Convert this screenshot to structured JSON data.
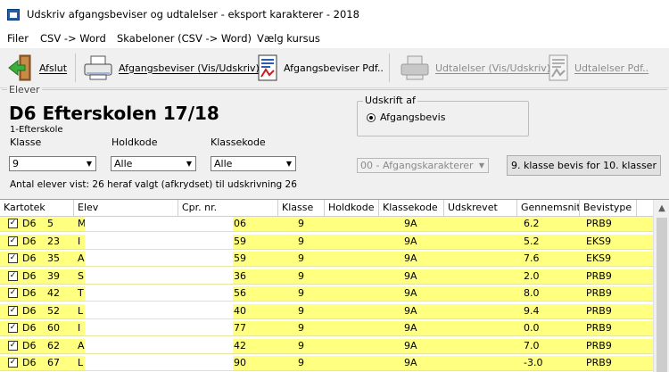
{
  "window": {
    "title": "Udskriv afgangsbeviser og udtalelser - eksport karakterer - 2018"
  },
  "menu": [
    "Filer",
    "CSV -> Word",
    "Skabeloner (CSV -> Word)",
    "Vælg kursus"
  ],
  "toolbar": {
    "exit": "Afslut",
    "certificates": "Afgangsbeviser (Vis/Udskriv)",
    "certificates_pdf": "Afgangsbeviser Pdf..",
    "statements": "Udtalelser (Vis/Udskriv)",
    "statements_pdf": "Udtalelser Pdf..",
    "icons": [
      "exit-door-icon",
      "printer-icon",
      "pdf-document-icon",
      "printer-icon",
      "document-icon"
    ]
  },
  "panel": {
    "legend": "Elever",
    "school_title": "D6 Efterskolen 17/18",
    "school_subtitle": "1-Efterskole",
    "klasse_label": "Klasse",
    "klasse_value": "9",
    "holdkode_label": "Holdkode",
    "holdkode_value": "Alle",
    "klassekode_label": "Klassekode",
    "klassekode_value": "Alle",
    "print_group_title": "Udskrift af",
    "print_radio_label": "Afgangsbevis",
    "grades_combo": "00 - Afgangskarakterer",
    "bevis_button": "9. klasse bevis for 10. klasser",
    "count_text": "Antal elever vist: 26 heraf valgt (afkrydset) til udskrivning 26"
  },
  "grid": {
    "columns": [
      "Kartotek",
      "Elev",
      "Cpr. nr.",
      "Klasse",
      "Holdkode",
      "Klassekode",
      "Udskrevet",
      "Gennemsnit",
      "Bevistype"
    ],
    "rows": [
      {
        "check": "✓",
        "kartotek": "D6",
        "nr": "5",
        "elev": "M",
        "cpr": "06",
        "klasse": "9",
        "klassekode": "9A",
        "gennemsnit": "6.2",
        "bevistype": "PRB9"
      },
      {
        "check": "✓",
        "kartotek": "D6",
        "nr": "23",
        "elev": "I",
        "cpr": "59",
        "klasse": "9",
        "klassekode": "9A",
        "gennemsnit": "5.2",
        "bevistype": "EKS9"
      },
      {
        "check": "✓",
        "kartotek": "D6",
        "nr": "35",
        "elev": "A",
        "cpr": "59",
        "klasse": "9",
        "klassekode": "9A",
        "gennemsnit": "7.6",
        "bevistype": "EKS9"
      },
      {
        "check": "✓",
        "kartotek": "D6",
        "nr": "39",
        "elev": "S",
        "cpr": "36",
        "klasse": "9",
        "klassekode": "9A",
        "gennemsnit": "2.0",
        "bevistype": "PRB9"
      },
      {
        "check": "✓",
        "kartotek": "D6",
        "nr": "42",
        "elev": "T",
        "cpr": "56",
        "klasse": "9",
        "klassekode": "9A",
        "gennemsnit": "8.0",
        "bevistype": "PRB9"
      },
      {
        "check": "✓",
        "kartotek": "D6",
        "nr": "52",
        "elev": "L",
        "cpr": "40",
        "klasse": "9",
        "klassekode": "9A",
        "gennemsnit": "9.4",
        "bevistype": "PRB9"
      },
      {
        "check": "✓",
        "kartotek": "D6",
        "nr": "60",
        "elev": "I",
        "cpr": "77",
        "klasse": "9",
        "klassekode": "9A",
        "gennemsnit": "0.0",
        "bevistype": "PRB9"
      },
      {
        "check": "✓",
        "kartotek": "D6",
        "nr": "62",
        "elev": "A",
        "cpr": "42",
        "klasse": "9",
        "klassekode": "9A",
        "gennemsnit": "7.0",
        "bevistype": "PRB9"
      },
      {
        "check": "✓",
        "kartotek": "D6",
        "nr": "67",
        "elev": "L",
        "cpr": "90",
        "klasse": "9",
        "klassekode": "9A",
        "gennemsnit": "-3.0",
        "bevistype": "PRB9"
      }
    ]
  },
  "colors": {
    "row_highlight": "#ffff80",
    "accent": "#1f5fa8"
  }
}
